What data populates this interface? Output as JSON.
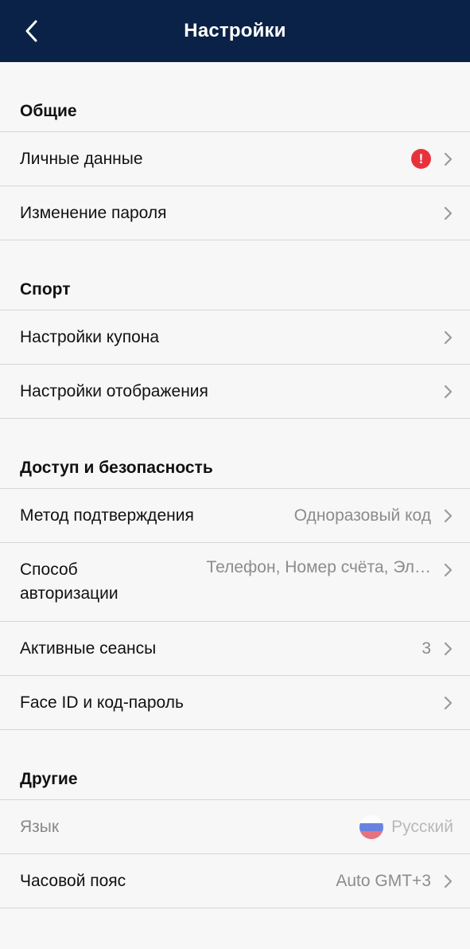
{
  "header": {
    "title": "Настройки",
    "back_icon": "chevron-left-icon"
  },
  "sections": [
    {
      "title": "Общие",
      "items": [
        {
          "label": "Личные данные",
          "badge": "!"
        },
        {
          "label": "Изменение пароля"
        }
      ]
    },
    {
      "title": "Спорт",
      "items": [
        {
          "label": "Настройки купона"
        },
        {
          "label": "Настройки отображения"
        }
      ]
    },
    {
      "title": "Доступ и безопасность",
      "items": [
        {
          "label": "Метод подтверждения",
          "value": "Одноразовый код"
        },
        {
          "label": "Способ\nавторизации",
          "value": "Телефон, Номер счёта, Эл…"
        },
        {
          "label": "Активные сеансы",
          "value": "3"
        },
        {
          "label": "Face ID и код-пароль"
        }
      ]
    },
    {
      "title": "Другие",
      "items": [
        {
          "label": "Язык",
          "value": "Русский",
          "flag_colors": [
            "#ffffff",
            "#3a5bd9",
            "#e0465a"
          ]
        },
        {
          "label": "Часовой пояс",
          "value": "Auto GMT+3"
        }
      ]
    }
  ],
  "colors": {
    "header_bg": "#0a2247",
    "alert": "#e8323b",
    "background": "#f7f7f7"
  }
}
